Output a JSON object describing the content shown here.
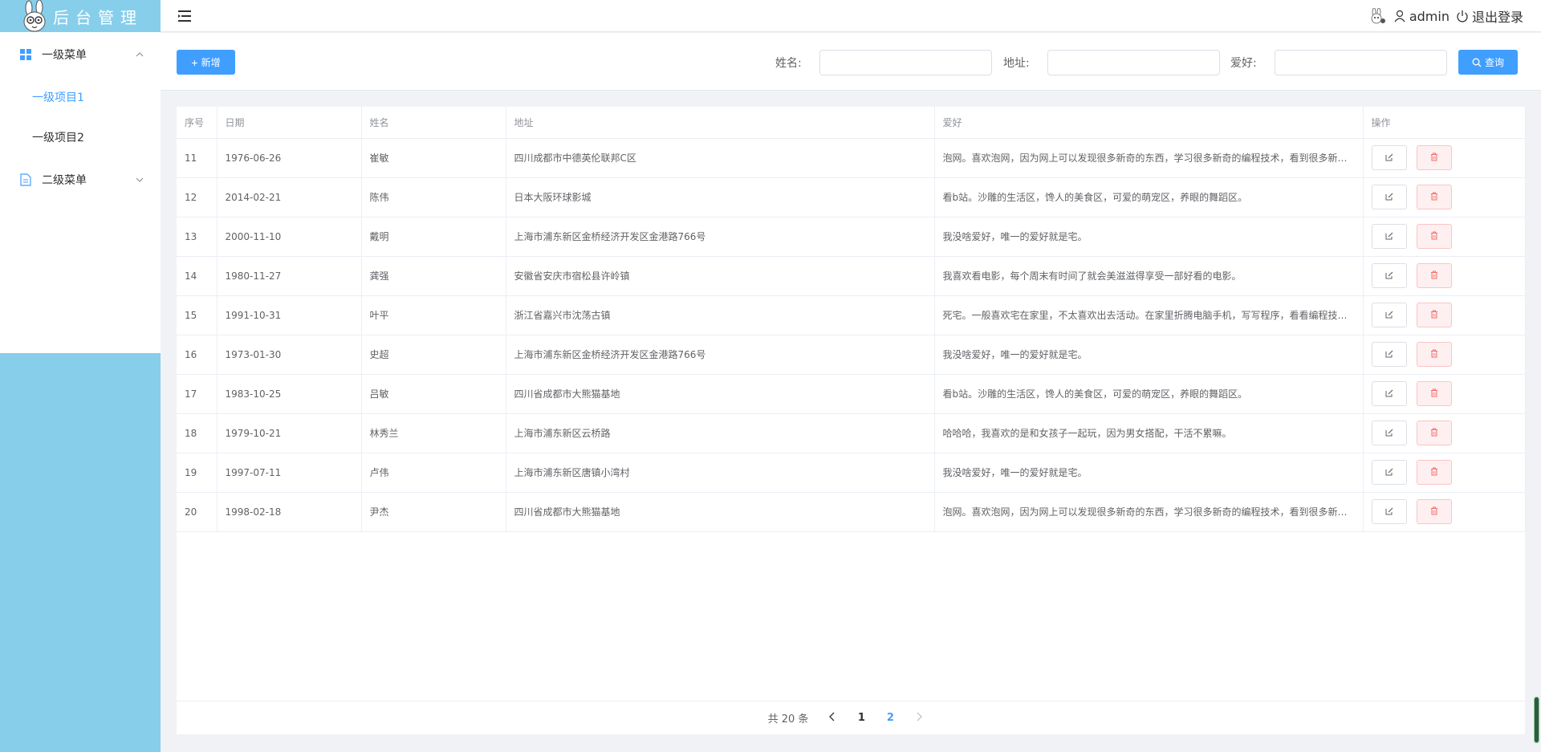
{
  "app": {
    "title": "后台管理"
  },
  "sidebar": {
    "menus": [
      {
        "label": "一级菜单",
        "icon": "grid-icon",
        "expanded": true,
        "items": [
          {
            "label": "一级项目1",
            "active": true
          },
          {
            "label": "一级项目2",
            "active": false
          }
        ]
      },
      {
        "label": "二级菜单",
        "icon": "document-icon",
        "expanded": false,
        "items": []
      }
    ]
  },
  "header": {
    "username": "admin",
    "logout_label": "退出登录"
  },
  "search": {
    "add_label": "新增",
    "name_label": "姓名:",
    "name_value": "",
    "address_label": "地址:",
    "address_value": "",
    "hobby_label": "爱好:",
    "hobby_value": "",
    "search_label": "查询"
  },
  "table": {
    "columns": [
      "序号",
      "日期",
      "姓名",
      "地址",
      "爱好",
      "操作"
    ],
    "rows": [
      [
        "11",
        "1976-06-26",
        "崔敏",
        "四川成都市中德英伦联邦C区",
        "泡网。喜欢泡网，因为网上可以发现很多新奇的东西，学习很多新奇的编程技术，看到很多新奇的东西。"
      ],
      [
        "12",
        "2014-02-21",
        "陈伟",
        "日本大阪环球影城",
        "看b站。沙雕的生活区，馋人的美食区，可爱的萌宠区，养眼的舞蹈区。"
      ],
      [
        "13",
        "2000-11-10",
        "戴明",
        "上海市浦东新区金桥经济开发区金港路766号",
        "我没啥爱好，唯一的爱好就是宅。"
      ],
      [
        "14",
        "1980-11-27",
        "龚强",
        "安徽省安庆市宿松县许岭镇",
        "我喜欢看电影，每个周末有时间了就会美滋滋得享受一部好看的电影。"
      ],
      [
        "15",
        "1991-10-31",
        "叶平",
        "浙江省嘉兴市沈荡古镇",
        "死宅。一般喜欢宅在家里，不太喜欢出去活动。在家里折腾电脑手机，写写程序，看看编程技术书籍。"
      ],
      [
        "16",
        "1973-01-30",
        "史超",
        "上海市浦东新区金桥经济开发区金港路766号",
        "我没啥爱好，唯一的爱好就是宅。"
      ],
      [
        "17",
        "1983-10-25",
        "吕敏",
        "四川省成都市大熊猫基地",
        "看b站。沙雕的生活区，馋人的美食区，可爱的萌宠区，养眼的舞蹈区。"
      ],
      [
        "18",
        "1979-10-21",
        "林秀兰",
        "上海市浦东新区云桥路",
        "哈哈哈，我喜欢的是和女孩子一起玩，因为男女搭配，干活不累嘛。"
      ],
      [
        "19",
        "1997-07-11",
        "卢伟",
        "上海市浦东新区唐镇小湾村",
        "我没啥爱好，唯一的爱好就是宅。"
      ],
      [
        "20",
        "1998-02-18",
        "尹杰",
        "四川省成都市大熊猫基地",
        "泡网。喜欢泡网，因为网上可以发现很多新奇的东西，学习很多新奇的编程技术，看到很多新奇的东西。"
      ]
    ]
  },
  "pagination": {
    "total_text": "共 20 条",
    "pages": [
      "1",
      "2"
    ],
    "current_page": "2"
  },
  "colors": {
    "sidebar_bg": "#87ceeb",
    "primary": "#409eff",
    "danger_bg": "#fef0f0"
  }
}
